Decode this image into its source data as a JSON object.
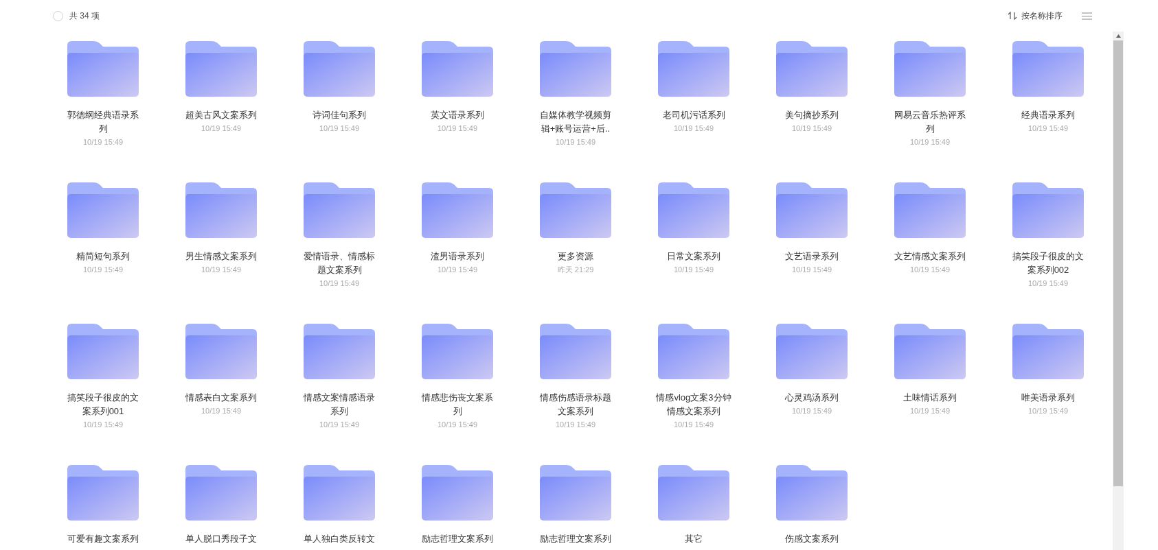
{
  "toolbar": {
    "selection_checked": false,
    "count": "共 34 项",
    "sort_label": "按名称排序"
  },
  "folders": [
    {
      "name": "郭德纲经典语录系列",
      "date": "10/19 15:49"
    },
    {
      "name": "超美古风文案系列",
      "date": "10/19 15:49"
    },
    {
      "name": "诗词佳句系列",
      "date": "10/19 15:49"
    },
    {
      "name": "英文语录系列",
      "date": "10/19 15:49"
    },
    {
      "name": "自媒体教学视频剪辑+账号运营+后..",
      "date": "10/19 15:49"
    },
    {
      "name": "老司机污话系列",
      "date": "10/19 15:49"
    },
    {
      "name": "美句摘抄系列",
      "date": "10/19 15:49"
    },
    {
      "name": "网易云音乐热评系列",
      "date": "10/19 15:49"
    },
    {
      "name": "经典语录系列",
      "date": "10/19 15:49"
    },
    {
      "name": "精简短句系列",
      "date": "10/19 15:49"
    },
    {
      "name": "男生情感文案系列",
      "date": "10/19 15:49"
    },
    {
      "name": "爱情语录、情感标题文案系列",
      "date": "10/19 15:49"
    },
    {
      "name": "渣男语录系列",
      "date": "10/19 15:49"
    },
    {
      "name": "更多资源",
      "date": "昨天 21:29"
    },
    {
      "name": "日常文案系列",
      "date": "10/19 15:49"
    },
    {
      "name": "文艺语录系列",
      "date": "10/19 15:49"
    },
    {
      "name": "文艺情感文案系列",
      "date": "10/19 15:49"
    },
    {
      "name": "搞笑段子很皮的文案系列002",
      "date": "10/19 15:49"
    },
    {
      "name": "搞笑段子很皮的文案系列001",
      "date": "10/19 15:49"
    },
    {
      "name": "情感表白文案系列",
      "date": "10/19 15:49"
    },
    {
      "name": "情感文案情感语录系列",
      "date": "10/19 15:49"
    },
    {
      "name": "情感悲伤丧文案系列",
      "date": "10/19 15:49"
    },
    {
      "name": "情感伤感语录标题文案系列",
      "date": "10/19 15:49"
    },
    {
      "name": "情感vlog文案3分钟情感文案系列",
      "date": "10/19 15:49"
    },
    {
      "name": "心灵鸡汤系列",
      "date": "10/19 15:49"
    },
    {
      "name": "土味情话系列",
      "date": "10/19 15:49"
    },
    {
      "name": "唯美语录系列",
      "date": "10/19 15:49"
    },
    {
      "name": "可爱有趣文案系列"
    },
    {
      "name": "单人脱口秀段子文"
    },
    {
      "name": "单人独白类反转文"
    },
    {
      "name": "励志哲理文案系列"
    },
    {
      "name": "励志哲理文案系列"
    },
    {
      "name": "其它"
    },
    {
      "name": "伤感文案系列"
    }
  ]
}
